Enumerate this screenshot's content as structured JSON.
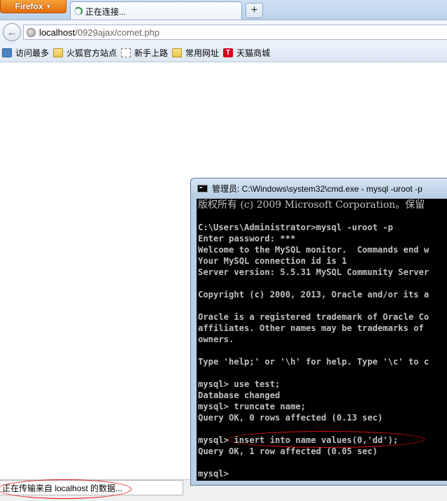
{
  "browser": {
    "app_button": "Firefox",
    "tab_title": "正在连接...",
    "new_tab_label": "+",
    "url_host": "localhost",
    "url_path": "/0929ajax/comet.php",
    "bookmarks": [
      {
        "label": "访问最多",
        "icon": "most-visited-icon"
      },
      {
        "label": "火狐官方站点",
        "icon": "folder-icon"
      },
      {
        "label": "新手上路",
        "icon": "blank-page-icon"
      },
      {
        "label": "常用网址",
        "icon": "folder-icon"
      },
      {
        "label": "天猫商城",
        "icon": "tmall-icon"
      }
    ],
    "status_text": "正在传输来自 localhost 的数据..."
  },
  "cmd_window": {
    "title": "管理员: C:\\Windows\\system32\\cmd.exe - mysql  -uroot -p",
    "lines": [
      "版权所有 (c) 2009 Microsoft Corporation。保留",
      "",
      "C:\\Users\\Administrator>mysql -uroot -p",
      "Enter password: ***",
      "Welcome to the MySQL monitor.  Commands end w",
      "Your MySQL connection id is 1",
      "Server version: 5.5.31 MySQL Community Server",
      "",
      "Copyright (c) 2000, 2013, Oracle and/or its a",
      "",
      "Oracle is a registered trademark of Oracle Co",
      "affiliates. Other names may be trademarks of",
      "owners.",
      "",
      "Type 'help;' or '\\h' for help. Type '\\c' to c",
      "",
      "mysql> use test;",
      "Database changed",
      "mysql> truncate name;",
      "Query OK, 0 rows affected (0.13 sec)",
      "",
      "mysql> insert into name values(0,'dd');",
      "Query OK, 1 row affected (0.05 sec)",
      "",
      "mysql>"
    ]
  }
}
